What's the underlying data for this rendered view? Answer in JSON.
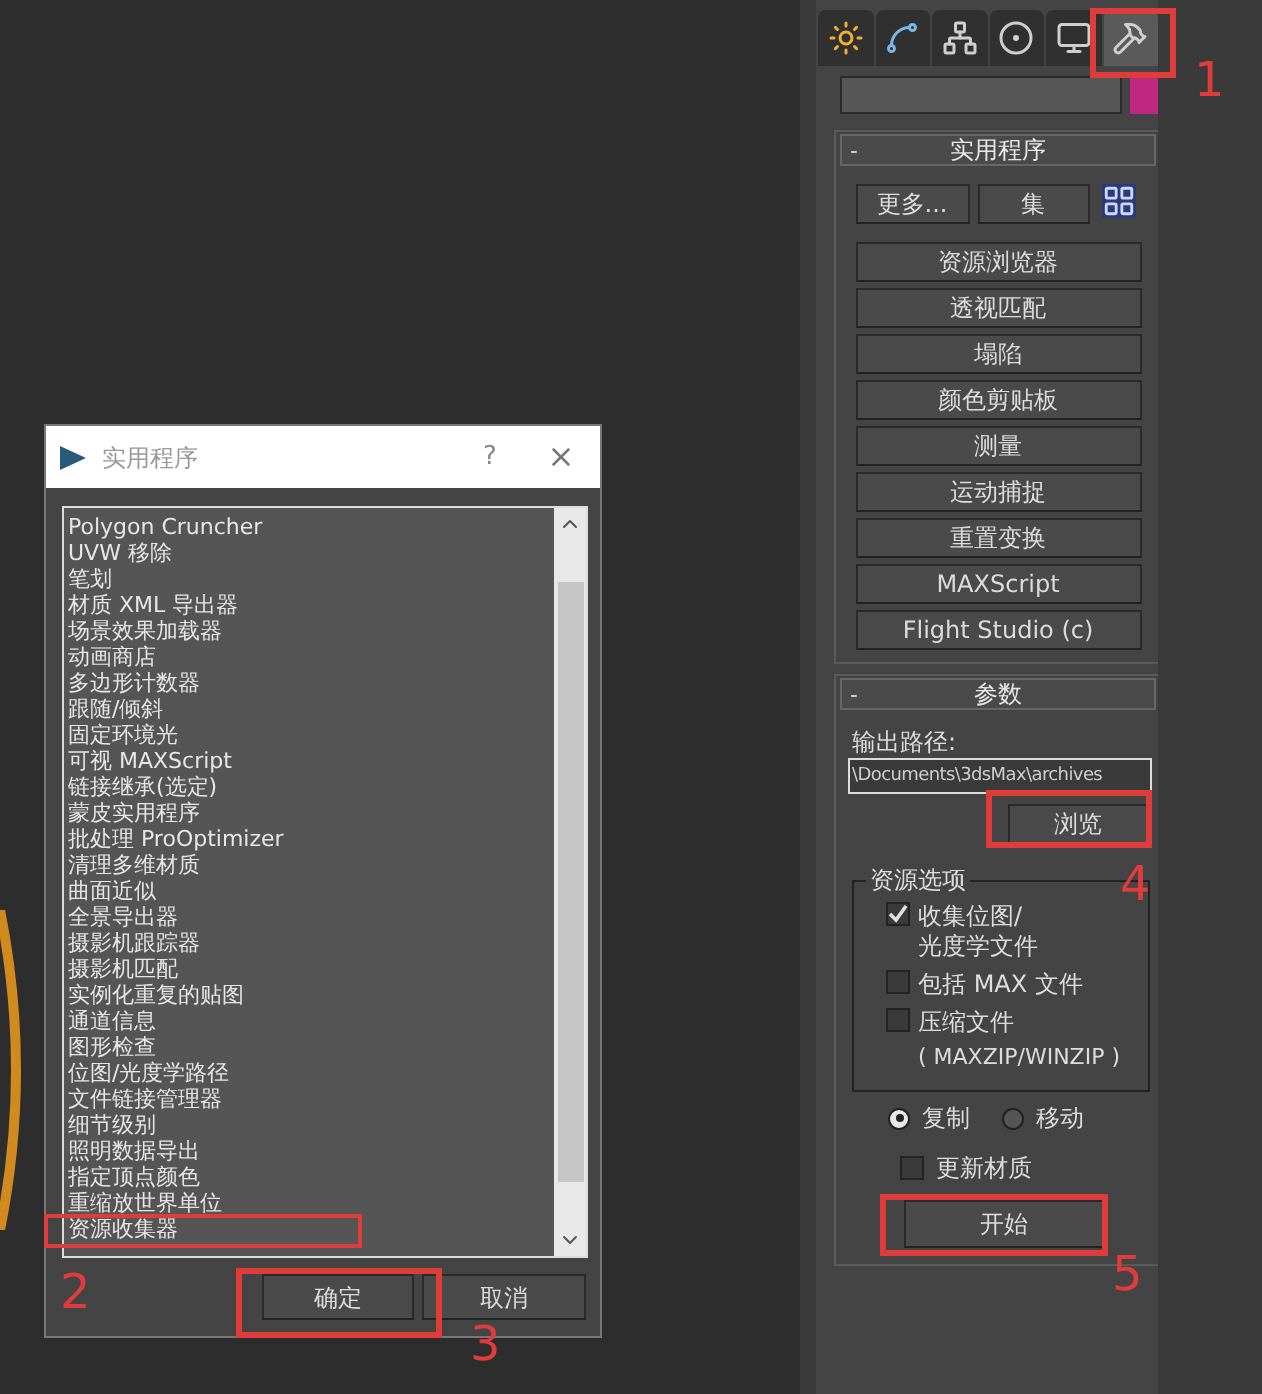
{
  "command_panel": {
    "tabs": [
      {
        "kind": "create",
        "selected": false
      },
      {
        "kind": "modify",
        "selected": false
      },
      {
        "kind": "hierarchy",
        "selected": false
      },
      {
        "kind": "motion",
        "selected": false
      },
      {
        "kind": "display",
        "selected": false
      },
      {
        "kind": "utilities",
        "selected": true
      }
    ],
    "utilities_rollout": {
      "title": "实用程序",
      "collapse": "-",
      "more_button": "更多...",
      "sets_button": "集",
      "buttons": [
        "资源浏览器",
        "透视匹配",
        "塌陷",
        "颜色剪贴板",
        "测量",
        "运动捕捉",
        "重置变换",
        "MAXScript",
        "Flight Studio (c)"
      ]
    },
    "parameters_rollout": {
      "title": "参数",
      "collapse": "-",
      "output_path_label": "输出路径:",
      "output_path": "\\Documents\\3dsMax\\archives",
      "browse_button": "浏览",
      "group_title": "资源选项",
      "options": [
        {
          "label": "收集位图/\n光度学文件",
          "checked": true
        },
        {
          "label": "包括 MAX 文件",
          "checked": false
        },
        {
          "label": "压缩文件",
          "note": "( MAXZIP/WINZIP )",
          "checked": false
        }
      ],
      "mode": [
        {
          "label": "复制",
          "selected": true
        },
        {
          "label": "移动",
          "selected": false
        }
      ],
      "update_materials": {
        "label": "更新材质",
        "checked": false
      },
      "start_button": "开始"
    }
  },
  "dialog": {
    "title": "实用程序",
    "help": "?",
    "items": [
      {
        "label": "Polygon Cruncher",
        "selected": false
      },
      {
        "label": "UVW 移除",
        "selected": false
      },
      {
        "label": "笔划",
        "selected": false
      },
      {
        "label": "材质 XML 导出器",
        "selected": false
      },
      {
        "label": "场景效果加载器",
        "selected": false
      },
      {
        "label": "动画商店",
        "selected": false
      },
      {
        "label": "多边形计数器",
        "selected": false
      },
      {
        "label": "跟随/倾斜",
        "selected": false
      },
      {
        "label": "固定环境光",
        "selected": false
      },
      {
        "label": "可视 MAXScript",
        "selected": false
      },
      {
        "label": "链接继承(选定)",
        "selected": false
      },
      {
        "label": "蒙皮实用程序",
        "selected": false
      },
      {
        "label": "批处理 ProOptimizer",
        "selected": false
      },
      {
        "label": "清理多维材质",
        "selected": false
      },
      {
        "label": "曲面近似",
        "selected": false
      },
      {
        "label": "全景导出器",
        "selected": false
      },
      {
        "label": "摄影机跟踪器",
        "selected": false
      },
      {
        "label": "摄影机匹配",
        "selected": false
      },
      {
        "label": "实例化重复的贴图",
        "selected": false
      },
      {
        "label": "通道信息",
        "selected": false
      },
      {
        "label": "图形检查",
        "selected": false
      },
      {
        "label": "位图/光度学路径",
        "selected": false
      },
      {
        "label": "文件链接管理器",
        "selected": false
      },
      {
        "label": "细节级别",
        "selected": false
      },
      {
        "label": "照明数据导出",
        "selected": false
      },
      {
        "label": "指定顶点颜色",
        "selected": false
      },
      {
        "label": "重缩放世界单位",
        "selected": false
      },
      {
        "label": "资源收集器",
        "selected": false
      }
    ],
    "ok_button": "确定",
    "cancel_button": "取消"
  },
  "annotations": [
    {
      "number": "1"
    },
    {
      "number": "2"
    },
    {
      "number": "3"
    },
    {
      "number": "4"
    },
    {
      "number": "5"
    }
  ]
}
